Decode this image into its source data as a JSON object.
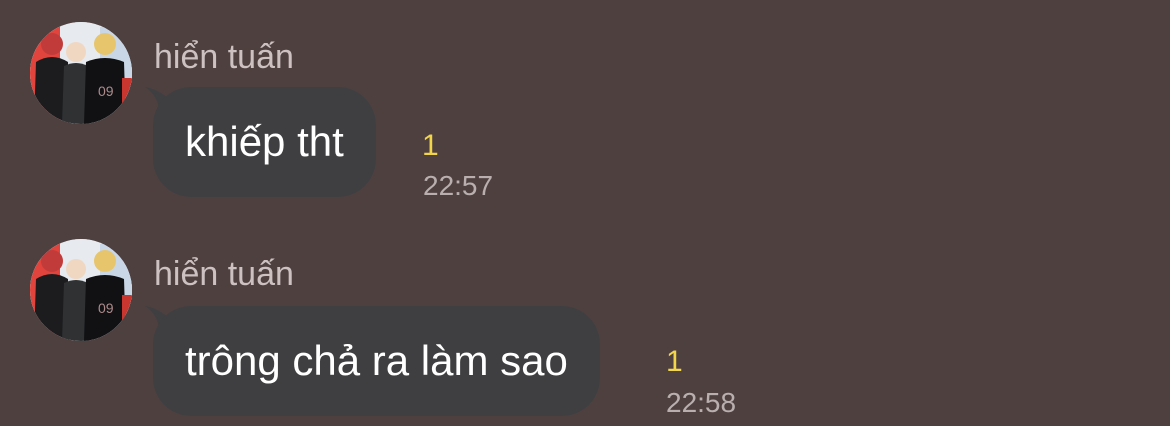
{
  "messages": [
    {
      "sender": "hiển tuấn",
      "text": "khiếp tht",
      "unread": "1",
      "time": "22:57",
      "avatar_icon": "profile-photo"
    },
    {
      "sender": "hiển tuấn",
      "text": "trông chả ra làm sao",
      "unread": "1",
      "time": "22:58",
      "avatar_icon": "profile-photo"
    }
  ],
  "colors": {
    "background": "#4f4040",
    "bubble": "#3f3f41",
    "unread": "#f2d64a"
  }
}
